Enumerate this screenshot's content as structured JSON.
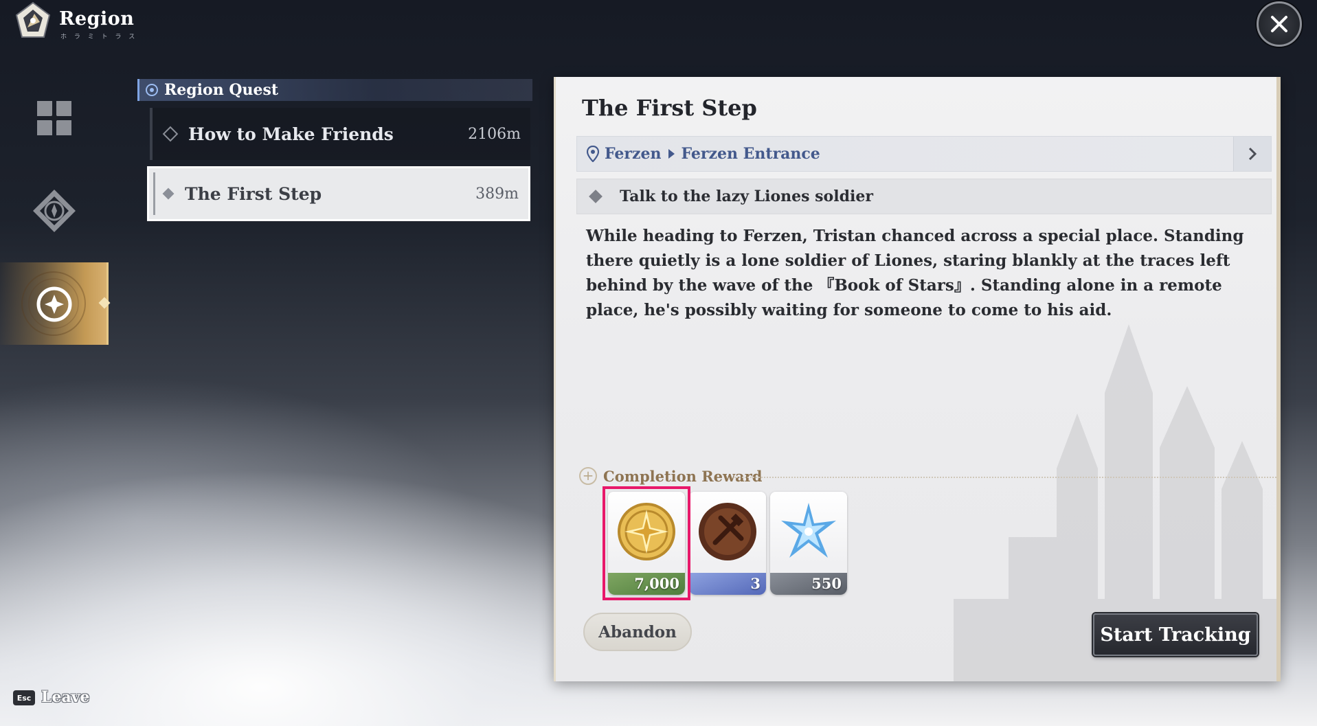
{
  "header": {
    "title": "Region",
    "subtitle": "ホ ラ ミ ト ラ ス",
    "close_icon": "close-icon"
  },
  "sidebar": {
    "items": [
      {
        "icon": "grid-icon",
        "active": false
      },
      {
        "icon": "compass-diamond-icon",
        "active": false
      },
      {
        "icon": "star-compass-icon",
        "active": true
      }
    ]
  },
  "quest_list": {
    "category": "Region Quest",
    "quests": [
      {
        "name": "How to Make Friends",
        "distance": "2106m",
        "selected": false
      },
      {
        "name": "The First Step",
        "distance": "389m",
        "selected": true
      }
    ]
  },
  "detail": {
    "title": "The First Step",
    "location": {
      "region": "Ferzen",
      "place": "Ferzen Entrance"
    },
    "objective": "Talk to the lazy Liones soldier",
    "description": "While heading to Ferzen, Tristan chanced across a special place. Standing there quietly is a lone soldier of Liones, staring blankly at the traces left behind by the wave of the 『Book of Stars』. Standing alone in a remote place, he's possibly waiting for someone to come to his aid.",
    "reward_label": "Completion Reward",
    "rewards": [
      {
        "icon": "gold-coin-icon",
        "amount": "7,000",
        "highlighted": true
      },
      {
        "icon": "hammer-medal-icon",
        "amount": "3"
      },
      {
        "icon": "blue-crystal-icon",
        "amount": "550"
      }
    ],
    "abandon_label": "Abandon",
    "track_label": "Start Tracking"
  },
  "footer": {
    "key": "Esc",
    "leave_label": "Leave"
  },
  "colors": {
    "location_text": "#43598c",
    "reward_label": "#8e7452",
    "highlight": "#e8186a"
  }
}
